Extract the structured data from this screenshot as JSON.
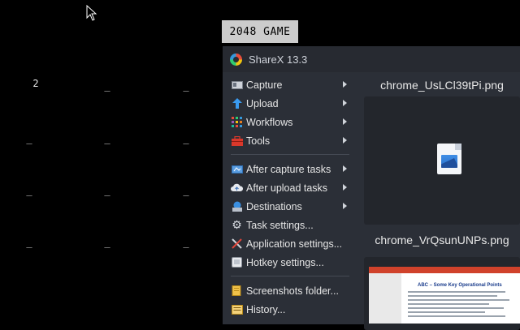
{
  "game": {
    "title": "2048  GAME",
    "cells": [
      [
        "2",
        "_",
        "_"
      ],
      [
        "_",
        "_",
        "_"
      ],
      [
        "_",
        "_",
        "_"
      ],
      [
        "_",
        "_",
        "_"
      ]
    ]
  },
  "sharex": {
    "title": "ShareX 13.3",
    "menu": [
      {
        "label": "Capture",
        "icon": "capture-icon",
        "submenu": true
      },
      {
        "label": "Upload",
        "icon": "upload-arrow-icon",
        "submenu": true
      },
      {
        "label": "Workflows",
        "icon": "workflows-grid-icon",
        "submenu": true
      },
      {
        "label": "Tools",
        "icon": "toolbox-icon",
        "submenu": true
      },
      {
        "label": "After capture tasks",
        "icon": "after-capture-icon",
        "submenu": true
      },
      {
        "label": "After upload tasks",
        "icon": "cloud-upload-icon",
        "submenu": true
      },
      {
        "label": "Destinations",
        "icon": "destinations-icon",
        "submenu": true
      },
      {
        "label": "Task settings...",
        "icon": "gear-icon",
        "submenu": false
      },
      {
        "label": "Application settings...",
        "icon": "wrench-screwdriver-icon",
        "submenu": false
      },
      {
        "label": "Hotkey settings...",
        "icon": "keyboard-icon",
        "submenu": false
      },
      {
        "label": "Screenshots folder...",
        "icon": "folder-icon",
        "submenu": false
      },
      {
        "label": "History...",
        "icon": "history-icon",
        "submenu": false
      }
    ],
    "thumbnails": [
      {
        "filename": "chrome_UsLCl39tPi.png",
        "preview": "image-file-icon"
      },
      {
        "filename": "chrome_VrQsunUNPs.png",
        "preview": "document-preview",
        "preview_heading": "ABC – Some Key Operational Points"
      }
    ]
  }
}
